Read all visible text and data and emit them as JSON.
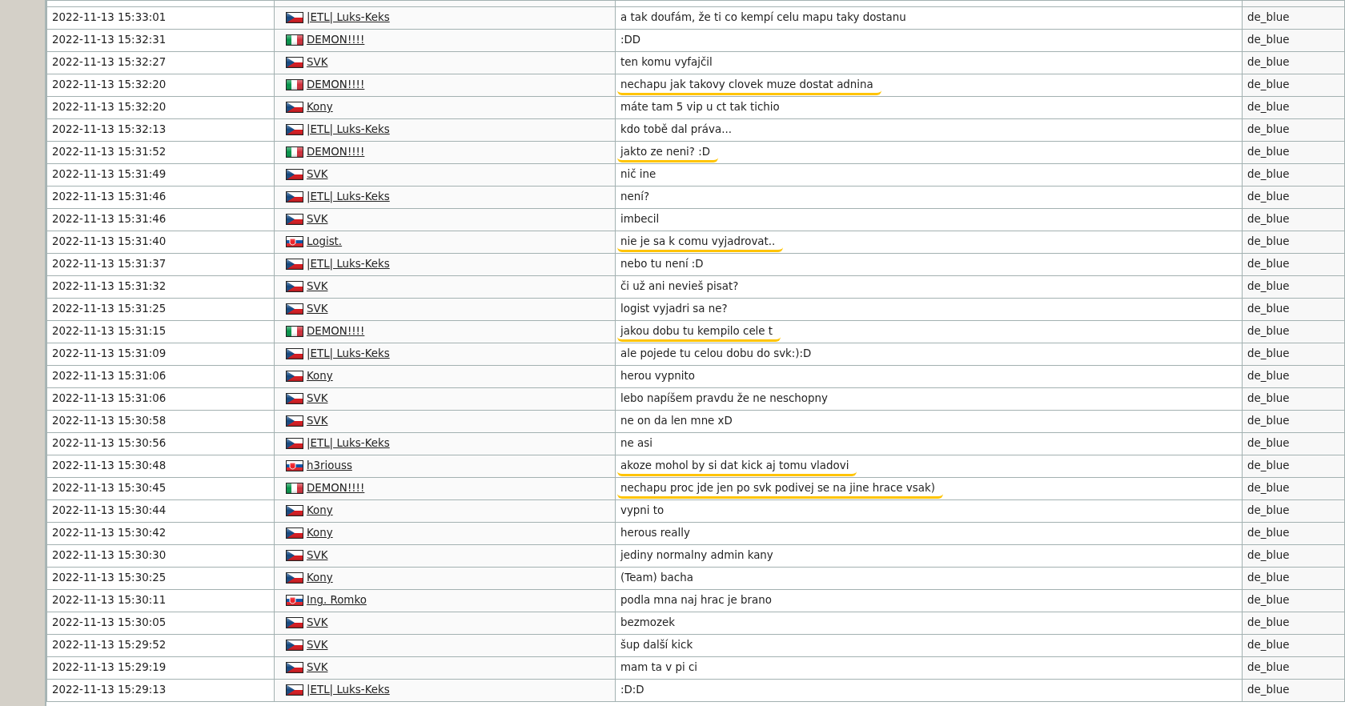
{
  "rows": [
    {
      "time": "2022-11-13 15:33:01",
      "kind": "cz",
      "player": "|ETL| Luks-Keks",
      "message": "a tak doufám, že ti co kempí celu mapu taky dostanu",
      "highlighted": false,
      "map": "de_blue"
    },
    {
      "time": "2022-11-13 15:32:31",
      "kind": "it",
      "player": "DEMON!!!!",
      "message": ":DD",
      "highlighted": false,
      "map": "de_blue"
    },
    {
      "time": "2022-11-13 15:32:27",
      "kind": "cz",
      "player": "SVK",
      "message": "ten komu vyfajčil",
      "highlighted": false,
      "map": "de_blue"
    },
    {
      "time": "2022-11-13 15:32:20",
      "kind": "it",
      "player": "DEMON!!!!",
      "message": "nechapu jak takovy clovek muze dostat adnina",
      "highlighted": true,
      "map": "de_blue"
    },
    {
      "time": "2022-11-13 15:32:20",
      "kind": "cz",
      "player": "Kony",
      "message": "máte tam 5 vip u ct tak tichio",
      "highlighted": false,
      "map": "de_blue"
    },
    {
      "time": "2022-11-13 15:32:13",
      "kind": "cz",
      "player": "|ETL| Luks-Keks",
      "message": "kdo tobě dal práva...",
      "highlighted": false,
      "map": "de_blue"
    },
    {
      "time": "2022-11-13 15:31:52",
      "kind": "it",
      "player": "DEMON!!!!",
      "message": "jakto ze neni? :D",
      "highlighted": true,
      "map": "de_blue"
    },
    {
      "time": "2022-11-13 15:31:49",
      "kind": "cz",
      "player": "SVK",
      "message": "nič ine",
      "highlighted": false,
      "map": "de_blue"
    },
    {
      "time": "2022-11-13 15:31:46",
      "kind": "cz",
      "player": "|ETL| Luks-Keks",
      "message": "není?",
      "highlighted": false,
      "map": "de_blue"
    },
    {
      "time": "2022-11-13 15:31:46",
      "kind": "cz",
      "player": "SVK",
      "message": "imbecil",
      "highlighted": false,
      "map": "de_blue"
    },
    {
      "time": "2022-11-13 15:31:40",
      "kind": "sk",
      "player": "Logist.",
      "message": "nie je sa k comu vyjadrovat..",
      "highlighted": true,
      "map": "de_blue"
    },
    {
      "time": "2022-11-13 15:31:37",
      "kind": "cz",
      "player": "|ETL| Luks-Keks",
      "message": "nebo tu není :D",
      "highlighted": false,
      "map": "de_blue"
    },
    {
      "time": "2022-11-13 15:31:32",
      "kind": "cz",
      "player": "SVK",
      "message": "či už ani nevieš pisat?",
      "highlighted": false,
      "map": "de_blue"
    },
    {
      "time": "2022-11-13 15:31:25",
      "kind": "cz",
      "player": "SVK",
      "message": "logist vyjadri sa ne?",
      "highlighted": false,
      "map": "de_blue"
    },
    {
      "time": "2022-11-13 15:31:15",
      "kind": "it",
      "player": "DEMON!!!!",
      "message": "jakou dobu tu kempilo cele t",
      "highlighted": true,
      "map": "de_blue"
    },
    {
      "time": "2022-11-13 15:31:09",
      "kind": "cz",
      "player": "|ETL| Luks-Keks",
      "message": "ale pojede tu celou dobu do svk:):D",
      "highlighted": false,
      "map": "de_blue"
    },
    {
      "time": "2022-11-13 15:31:06",
      "kind": "cz",
      "player": "Kony",
      "message": "herou vypnito",
      "highlighted": false,
      "map": "de_blue"
    },
    {
      "time": "2022-11-13 15:31:06",
      "kind": "cz",
      "player": "SVK",
      "message": "lebo napíšem pravdu že ne neschopny",
      "highlighted": false,
      "map": "de_blue"
    },
    {
      "time": "2022-11-13 15:30:58",
      "kind": "cz",
      "player": "SVK",
      "message": "ne on da len mne xD",
      "highlighted": false,
      "map": "de_blue"
    },
    {
      "time": "2022-11-13 15:30:56",
      "kind": "cz",
      "player": "|ETL| Luks-Keks",
      "message": "ne asi",
      "highlighted": false,
      "map": "de_blue"
    },
    {
      "time": "2022-11-13 15:30:48",
      "kind": "sk",
      "player": "h3riouss",
      "message": "akoze mohol by si dat kick aj tomu vladovi",
      "highlighted": true,
      "map": "de_blue"
    },
    {
      "time": "2022-11-13 15:30:45",
      "kind": "it",
      "player": "DEMON!!!!",
      "message": "nechapu proc jde jen po svk podivej se na jine hrace vsak)",
      "highlighted": true,
      "map": "de_blue"
    },
    {
      "time": "2022-11-13 15:30:44",
      "kind": "cz",
      "player": "Kony",
      "message": "vypni to",
      "highlighted": false,
      "map": "de_blue"
    },
    {
      "time": "2022-11-13 15:30:42",
      "kind": "cz",
      "player": "Kony",
      "message": "herous really",
      "highlighted": false,
      "map": "de_blue"
    },
    {
      "time": "2022-11-13 15:30:30",
      "kind": "cz",
      "player": "SVK",
      "message": "jediny normalny admin kany",
      "highlighted": false,
      "map": "de_blue"
    },
    {
      "time": "2022-11-13 15:30:25",
      "kind": "cz",
      "player": "Kony",
      "message": "(Team) bacha",
      "highlighted": false,
      "map": "de_blue"
    },
    {
      "time": "2022-11-13 15:30:11",
      "kind": "sk",
      "player": "Ing. Romko",
      "message": "podla mna naj hrac je brano",
      "highlighted": false,
      "map": "de_blue"
    },
    {
      "time": "2022-11-13 15:30:05",
      "kind": "cz",
      "player": "SVK",
      "message": "bezmozek",
      "highlighted": false,
      "map": "de_blue"
    },
    {
      "time": "2022-11-13 15:29:52",
      "kind": "cz",
      "player": "SVK",
      "message": "šup další kick",
      "highlighted": false,
      "map": "de_blue"
    },
    {
      "time": "2022-11-13 15:29:19",
      "kind": "cz",
      "player": "SVK",
      "message": "mam ta v pi ci",
      "highlighted": false,
      "map": "de_blue"
    },
    {
      "time": "2022-11-13 15:29:13",
      "kind": "cz",
      "player": "|ETL| Luks-Keks",
      "message": ":D:D",
      "highlighted": false,
      "map": "de_blue"
    }
  ]
}
